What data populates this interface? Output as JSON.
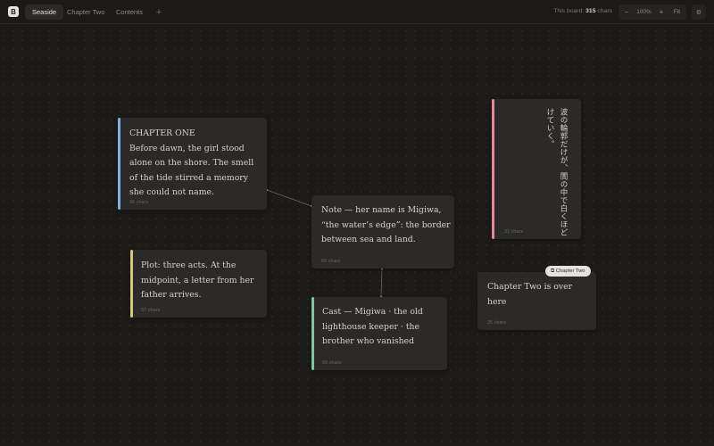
{
  "header": {
    "logo": "B",
    "tabs": [
      {
        "label": "Seaside"
      },
      {
        "label": "Chapter Two"
      },
      {
        "label": "Contents"
      }
    ],
    "add_tab": "+",
    "board_count_prefix": "This board:",
    "board_count_value": "315",
    "board_count_unit": "chars",
    "zoom_out": "−",
    "zoom_level": "100%",
    "zoom_in": "+",
    "fit_label": "Fit",
    "settings": "⚙"
  },
  "cards": {
    "chapter_one": {
      "title": "CHAPTER ONE",
      "body": "Before dawn, the girl stood alone on the shore. The smell of the tide stirred a memory she could not name.",
      "meta": "96 chars",
      "accent": "#7fb1dc"
    },
    "plot": {
      "body": "Plot: three acts. At the midpoint, a letter from her father arrives.",
      "meta": "57 chars",
      "accent": "#d9c57a"
    },
    "note": {
      "body": "Note — her name is Migiwa, “the water’s edge”: the border between sea and land.",
      "meta": "65 chars"
    },
    "cast": {
      "body": "Cast — Migiwa · the old lighthouse keeper · the brother who vanished",
      "meta": "66 chars",
      "accent": "#7cc6a4"
    },
    "japanese": {
      "line1": "波の輪郭だけが、闇の中で白くほど",
      "line2": "けていく。",
      "meta": "21 chars",
      "accent": "#e58a95"
    },
    "chapter_two_link": {
      "badge": "⧉ Chapter Two",
      "body": "Chapter Two is over here",
      "meta": "25 chars"
    }
  }
}
